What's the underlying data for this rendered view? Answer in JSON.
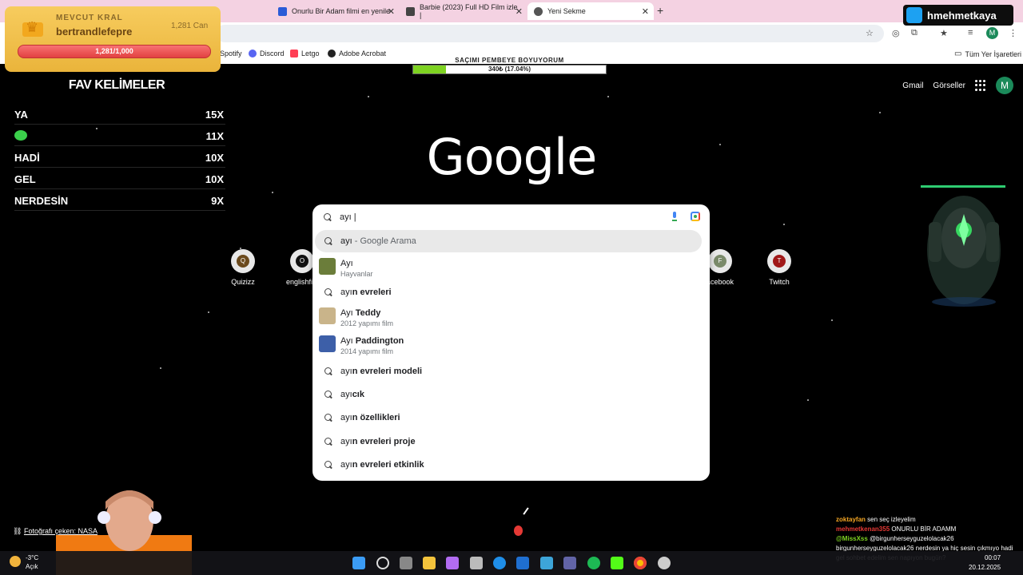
{
  "browser": {
    "tabs": [
      {
        "title": "Onurlu Bir Adam filmi en yenile",
        "fav_color": "#2a5bd7"
      },
      {
        "title": "Barbie (2023) Full HD Film izle |",
        "fav_color": "#444"
      },
      {
        "title": "Yeni Sekme",
        "fav_color": "#555"
      }
    ],
    "new_tab": "+",
    "close": "✕"
  },
  "bookmarks": {
    "items": [
      {
        "label": "Spotify",
        "color": "#1db954"
      },
      {
        "label": "Discord",
        "color": "#5865f2"
      },
      {
        "label": "Letgo",
        "color": "#ff3f55"
      },
      {
        "label": "Adobe Acrobat",
        "color": "#222"
      }
    ],
    "all_bookmarks": "Tüm Yer İşaretleri"
  },
  "goal": {
    "title": "SAÇIMI PEMBEYE BOYUYORUM",
    "text": "340₺ (17.04%)",
    "fraction": 0.1704
  },
  "google": {
    "logo": "Google",
    "links": [
      "Gmail",
      "Görseller"
    ],
    "avatar_letter": "M",
    "shortcuts": [
      {
        "label": "Quizizz",
        "letter": "Q",
        "color": "#6b4a1d"
      },
      {
        "label": "englishfile",
        "letter": "O",
        "color": "#111"
      },
      {
        "label": "acebook",
        "letter": "F",
        "color": "#7a8a6a"
      },
      {
        "label": "Twitch",
        "letter": "T",
        "color": "#a01818"
      }
    ],
    "photo_credit": "Fotoğrafı çeken: NASA"
  },
  "search": {
    "query": "ayı |",
    "suggestions": [
      {
        "type": "search",
        "bold": "ayı",
        "rest": " - Google Arama",
        "highlighted": true
      },
      {
        "type": "entity",
        "title": "Ayı",
        "subtitle": "Hayvanlar",
        "thumb_color": "#6b7d3a"
      },
      {
        "type": "search",
        "prefix": "ayı",
        "bold": "n evreleri"
      },
      {
        "type": "entity",
        "title_prefix": "Ayı ",
        "title_bold": "Teddy",
        "subtitle": "2012 yapımı film",
        "thumb_color": "#c9b48a"
      },
      {
        "type": "entity",
        "title_prefix": "Ayı ",
        "title_bold": "Paddington",
        "subtitle": "2014 yapımı film",
        "thumb_color": "#3d5fa8"
      },
      {
        "type": "search",
        "prefix": "ayı",
        "bold": "n evreleri modeli"
      },
      {
        "type": "search",
        "prefix": "ayı",
        "bold": "cık"
      },
      {
        "type": "search",
        "prefix": "ayı",
        "bold": "n özellikleri"
      },
      {
        "type": "search",
        "prefix": "ayı",
        "bold": "n evreleri proje"
      },
      {
        "type": "search",
        "prefix": "ayı",
        "bold": "n evreleri etkinlik"
      }
    ]
  },
  "stream": {
    "king_label": "MEVCUT KRAL",
    "king_name": "bertrandlefepre",
    "king_hp": "1,281 Can",
    "king_bar": "1,281/1,000",
    "fav_title": "FAV KELİMELER",
    "fav_words": [
      {
        "word": "YA",
        "count": "15X"
      },
      {
        "word": "",
        "emote": true,
        "count": "11X"
      },
      {
        "word": "HADİ",
        "count": "10X"
      },
      {
        "word": "GEL",
        "count": "10X"
      },
      {
        "word": "NERDESİN",
        "count": "9X"
      }
    ],
    "creator": "hmehmetkaya",
    "chat": [
      {
        "name": "zoktayfan",
        "color": "#f5a623",
        "msg": "sen seç izleyelim"
      },
      {
        "name": "mehmetkenan355",
        "color": "#e53935",
        "msg": "ONURLU BİR ADAMM"
      },
      {
        "name": "@MissXss",
        "color": "#7ed321",
        "msg": "@birgunherseyguzelolacak26"
      },
      {
        "name": "",
        "color": "#fff",
        "msg": "birgunherseyguzelolacak26 nerdesin ya hiç sesin çıkmıyo hadi gel sohbet edelim sen napıyon bugün?"
      }
    ]
  },
  "taskbar": {
    "temp": "-3°C",
    "weather": "Açık",
    "time": "00:07",
    "date": "20.12.2025"
  }
}
